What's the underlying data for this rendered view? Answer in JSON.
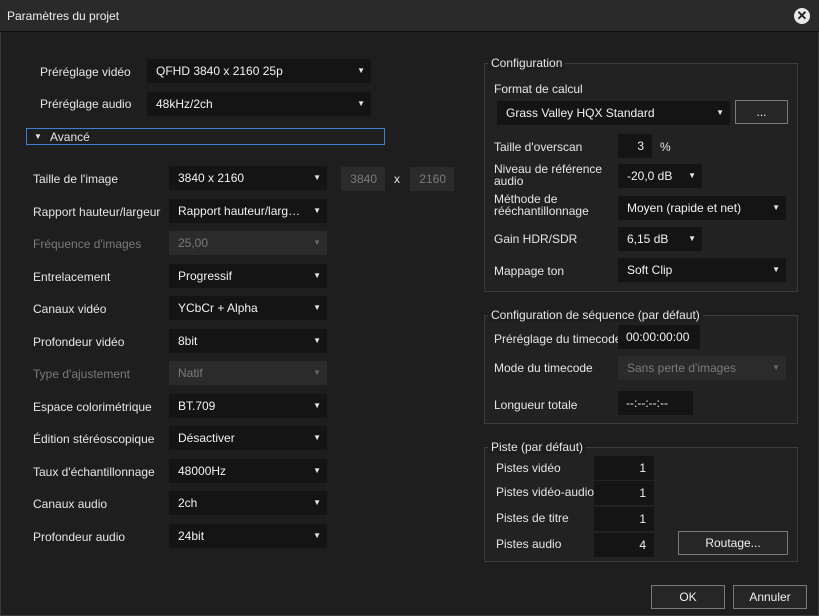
{
  "window": {
    "title": "Paramètres du projet"
  },
  "left": {
    "video_preset": {
      "label": "Préréglage vidéo",
      "value": "QFHD 3840 x 2160 25p"
    },
    "audio_preset": {
      "label": "Préréglage audio",
      "value": "48kHz/2ch"
    },
    "advanced_label": "Avancé",
    "image_size": {
      "label": "Taille de l'image",
      "value": "3840 x 2160",
      "width": "3840",
      "x": "x",
      "height": "2160"
    },
    "aspect_ratio": {
      "label": "Rapport hauteur/largeur",
      "value": "Rapport hauteur/largeur..."
    },
    "frame_rate": {
      "label": "Fréquence d'images",
      "value": "25,00"
    },
    "interlace": {
      "label": "Entrelacement",
      "value": "Progressif"
    },
    "video_channels": {
      "label": "Canaux vidéo",
      "value": "YCbCr + Alpha"
    },
    "video_depth": {
      "label": "Profondeur vidéo",
      "value": "8bit"
    },
    "fit_type": {
      "label": "Type d'ajustement",
      "value": "Natif"
    },
    "color_space": {
      "label": "Espace colorimétrique",
      "value": "BT.709"
    },
    "stereo_edit": {
      "label": "Édition stéréoscopique",
      "value": "Désactiver"
    },
    "sample_rate": {
      "label": "Taux d'échantillonnage",
      "value": "48000Hz"
    },
    "audio_channels": {
      "label": "Canaux audio",
      "value": "2ch"
    },
    "audio_depth": {
      "label": "Profondeur audio",
      "value": "24bit"
    }
  },
  "config": {
    "title": "Configuration",
    "format_label": "Format de calcul",
    "format_value": "Grass Valley HQX Standard",
    "format_btn": "...",
    "overscan_label": "Taille d'overscan",
    "overscan_value": "3",
    "overscan_unit": "%",
    "ref_level_label": "Niveau de référence audio",
    "ref_level_value": "-20,0 dB",
    "resample_label": "Méthode de rééchantillonnage",
    "resample_value": "Moyen (rapide et net)",
    "hdr_gain_label": "Gain HDR/SDR",
    "hdr_gain_value": "6,15 dB",
    "tone_label": "Mappage ton",
    "tone_value": "Soft Clip"
  },
  "sequence": {
    "title": "Configuration de séquence (par défaut)",
    "timecode_preset_label": "Préréglage du timecode",
    "timecode_preset_value": "00:00:00:00",
    "timecode_mode_label": "Mode du timecode",
    "timecode_mode_value": "Sans perte d'images",
    "total_length_label": "Longueur totale",
    "total_length_value": "--:--:--:--"
  },
  "track": {
    "title": "Piste (par défaut)",
    "video_tracks_label": "Pistes vidéo",
    "video_tracks_value": "1",
    "va_tracks_label": "Pistes vidéo-audio",
    "va_tracks_value": "1",
    "title_tracks_label": "Pistes de titre",
    "title_tracks_value": "1",
    "audio_tracks_label": "Pistes audio",
    "audio_tracks_value": "4",
    "routing_btn": "Routage..."
  },
  "footer": {
    "ok": "OK",
    "cancel": "Annuler"
  }
}
